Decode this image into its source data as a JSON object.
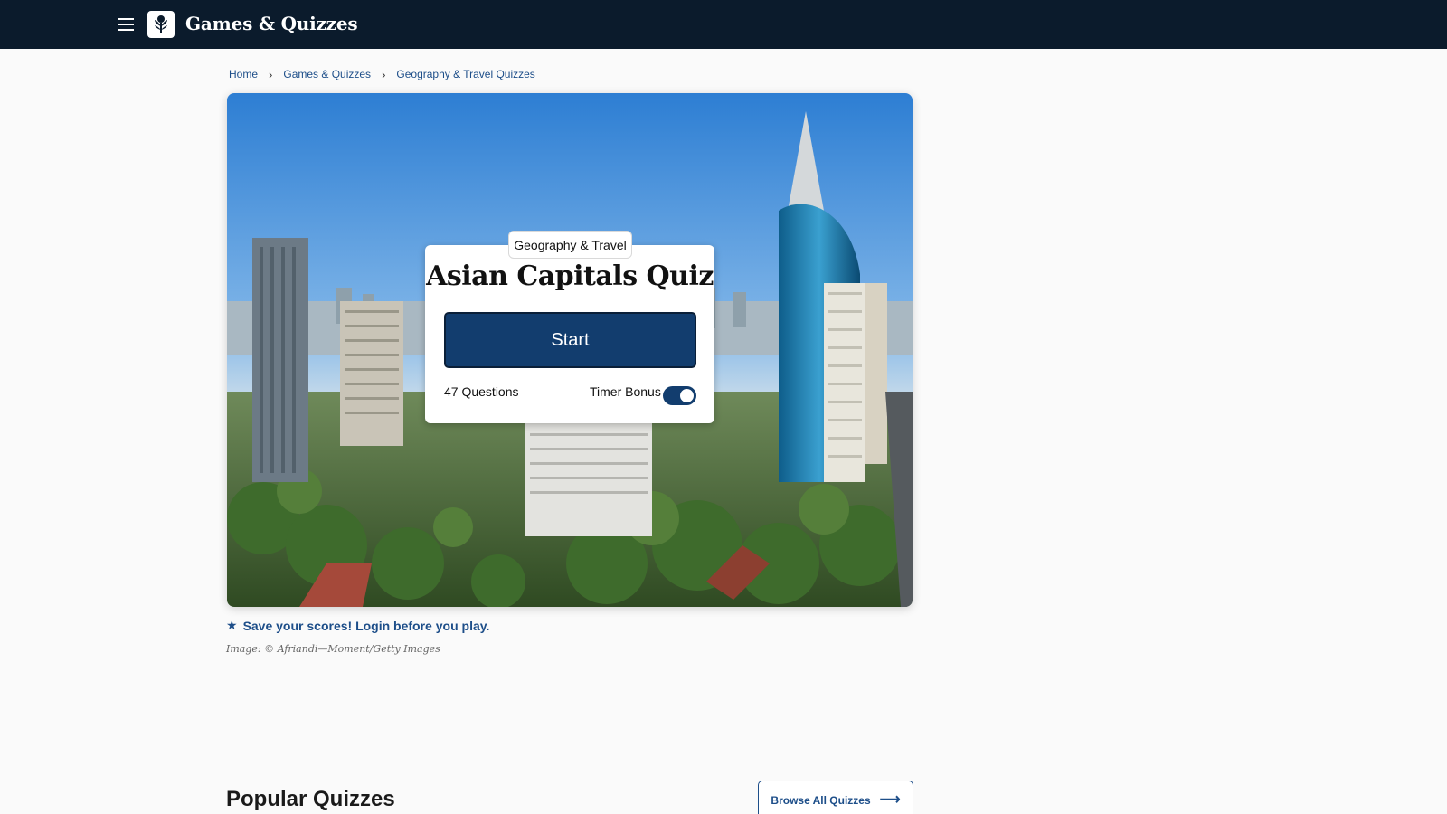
{
  "header": {
    "brand": "Games & Quizzes",
    "menu_icon": "hamburger-menu-icon",
    "logo_icon": "britannica-thistle-logo-icon"
  },
  "breadcrumb": {
    "items": [
      "Home",
      "Games & Quizzes",
      "Geography & Travel Quizzes"
    ],
    "separator": "›"
  },
  "quiz": {
    "category": "Geography & Travel",
    "title": "Asian Capitals Quiz",
    "start_label": "Start",
    "question_count": "47 Questions",
    "timer_label": "Timer Bonus",
    "timer_on": true
  },
  "hero_image": {
    "description_icon": "city-skyline-photo"
  },
  "save_prompt": {
    "icon": "star-icon",
    "text": "Save your scores! Login before you play."
  },
  "credit": "Image: © Afriandi—Moment/Getty Images",
  "popular": {
    "title": "Popular Quizzes",
    "browse_label": "Browse All Quizzes",
    "browse_icon": "arrow-right-icon"
  },
  "colors": {
    "topbar": "#0b1b2c",
    "primary": "#123d6e",
    "link": "#1d4e89"
  }
}
